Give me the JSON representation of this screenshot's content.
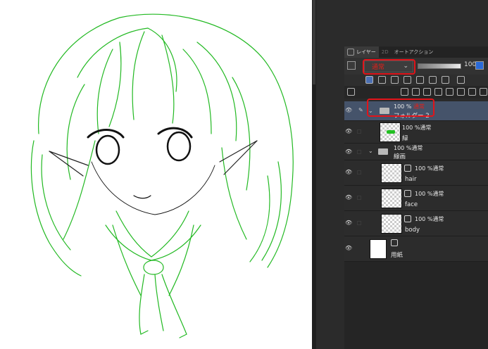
{
  "panel": {
    "tabs": [
      "レイヤー",
      "2D",
      "オートアクション"
    ],
    "blend_mode": "通常",
    "opacity": "100",
    "opacity_fraction": 1.0
  },
  "layers": [
    {
      "percent": "100 %",
      "mode": "通常",
      "name": "フォルダー 2",
      "type": "folder",
      "selected": true
    },
    {
      "percent": "100 %",
      "mode": "通常",
      "name": "緑",
      "type": "raster"
    },
    {
      "percent": "100 %",
      "mode": "通常",
      "name": "線画",
      "type": "folder"
    },
    {
      "percent": "100 %",
      "mode": "通常",
      "name": "hair",
      "type": "vector"
    },
    {
      "percent": "100 %",
      "mode": "通常",
      "name": "face",
      "type": "vector"
    },
    {
      "percent": "100 %",
      "mode": "通常",
      "name": "body",
      "type": "vector"
    },
    {
      "percent": "",
      "mode": "",
      "name": "用紙",
      "type": "paper"
    }
  ],
  "colors": {
    "accent_red": "#e2141a",
    "line_green": "#22c022",
    "selected_row": "#45536a"
  }
}
